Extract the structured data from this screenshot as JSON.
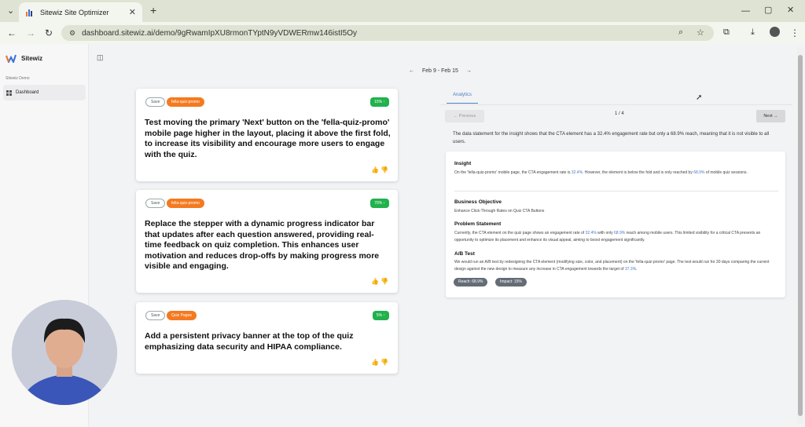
{
  "browser": {
    "tab_title": "Sitewiz Site Optimizer",
    "url": "dashboard.sitewiz.ai/demo/9gRwamIpXU8rmonTYptN9yVDWERmw146istI5Oy"
  },
  "sidebar": {
    "brand": "Sitewiz",
    "section": "Sitewiz Demo",
    "item": "Dashboard"
  },
  "datenav": {
    "prev": "←",
    "range": "Feb 9 - Feb 15",
    "next": "→"
  },
  "cards": [
    {
      "save": "Save",
      "tag": "fella-quiz-promo",
      "pct": "15% ↑",
      "text": "Test moving the primary 'Next' button on the 'fella-quiz-promo' mobile page higher in the layout, placing it above the first fold, to increase its visibility and encourage more users to engage with the quiz."
    },
    {
      "save": "Save",
      "tag": "fella-quiz-promo",
      "pct": "70% ↑",
      "text": "Replace the stepper with a dynamic progress indicator bar that updates after each question answered, providing real-time feedback on quiz completion. This enhances user motivation and reduces drop-offs by making progress more visible and engaging."
    },
    {
      "save": "Save",
      "tag": "Quiz Pages",
      "pct": "5% ↑",
      "text": "Add a persistent privacy banner at the top of the quiz emphasizing data security and HIPAA compliance."
    }
  ],
  "panel": {
    "tab": "Analytics",
    "prev": "← Previous",
    "page": "1 / 4",
    "next": "Next →",
    "statement": "The data statement for the insight shows that the CTA element has a 32.4% engagement rate but only a 68.9% reach, meaning that it is not visible to all users.",
    "insight_h": "Insight",
    "insight_1": "On the 'fella-quiz-promo' mobile page, the CTA engagement rate is ",
    "insight_v1": "32.4%",
    "insight_2": ". However, the element is below the fold and is only reached by ",
    "insight_v2": "68.9%",
    "insight_3": " of mobile quiz sessions.",
    "obj_h": "Business Objective",
    "obj": "Enhance Click-Through Rates on Quiz CTA Buttons",
    "prob_h": "Problem Statement",
    "prob_1": "Currently, the CTA element on the quiz page shows an engagement rate of ",
    "prob_v1": "32.4%",
    "prob_2": " with only ",
    "prob_v2": "68.9%",
    "prob_3": " reach among mobile users. This limited visibility for a critical CTA presents an opportunity to optimize its placement and enhance its visual appeal, aiming to boost engagement significantly.",
    "ab_h": "A/B Test",
    "ab_1": "We would run an A/B test by redesigning the CTA element (modifying size, color, and placement) on the 'fella-quiz-promo' page. The test would run for 30 days comparing the current design against the new design to measure any increase in CTA engagement towards the target of ",
    "ab_v": "37.3%",
    "ab_2": ".",
    "reach": "Reach: 68.9%",
    "impact": "Impact: 15%"
  }
}
